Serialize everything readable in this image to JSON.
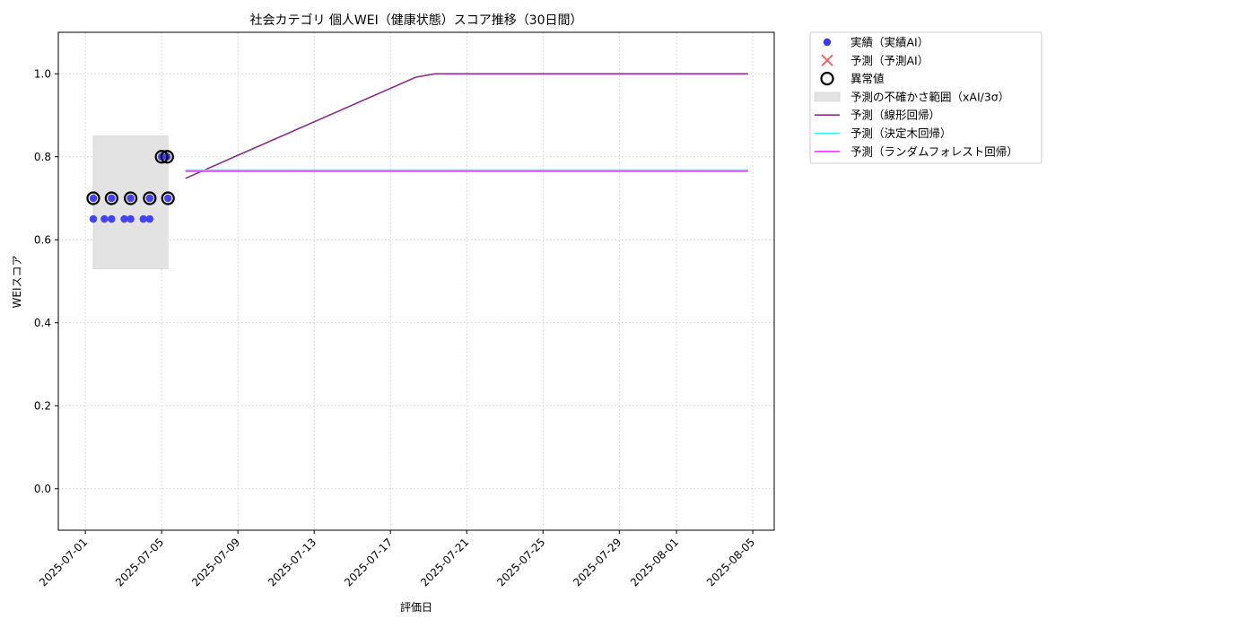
{
  "chart_data": {
    "type": "line",
    "title": "社会カテゴリ 個人WEI（健康状態）スコア推移（30日間）",
    "xlabel": "評価日",
    "ylabel": "WEIスコア",
    "xlim": [
      "2025-06-29 14:00",
      "2025-08-06 03:00"
    ],
    "ylim": [
      -0.1,
      1.1
    ],
    "x_ticks": [
      "2025-07-01",
      "2025-07-05",
      "2025-07-09",
      "2025-07-13",
      "2025-07-17",
      "2025-07-21",
      "2025-07-25",
      "2025-07-29",
      "2025-08-01",
      "2025-08-05"
    ],
    "y_ticks": [
      0.0,
      0.2,
      0.4,
      0.6,
      0.8,
      1.0
    ],
    "y_tick_labels": [
      "0.0",
      "0.2",
      "0.4",
      "0.6",
      "0.8",
      "1.0"
    ],
    "grid": true,
    "legend_position": "outside-top-right",
    "uncertainty_band": {
      "name": "予測の不確かさ範囲（xAI/3σ）",
      "x_start": "2025-07-01 10:00",
      "x_end": "2025-07-05 08:00",
      "y_low": 0.53,
      "y_high": 0.85,
      "color": "#e3e3e3"
    },
    "series": [
      {
        "name": "実績（実績AI）",
        "kind": "scatter",
        "color": "#3a3af2",
        "points": [
          [
            "2025-07-01 10:00",
            0.65
          ],
          [
            "2025-07-01 10:00",
            0.7
          ],
          [
            "2025-07-02 00:00",
            0.65
          ],
          [
            "2025-07-02 09:00",
            0.65
          ],
          [
            "2025-07-02 09:00",
            0.7
          ],
          [
            "2025-07-03 01:00",
            0.65
          ],
          [
            "2025-07-03 09:00",
            0.65
          ],
          [
            "2025-07-03 09:00",
            0.7
          ],
          [
            "2025-07-04 01:00",
            0.65
          ],
          [
            "2025-07-04 09:00",
            0.65
          ],
          [
            "2025-07-04 09:00",
            0.7
          ],
          [
            "2025-07-05 00:00",
            0.8
          ],
          [
            "2025-07-05 07:00",
            0.8
          ],
          [
            "2025-07-05 08:00",
            0.7
          ]
        ]
      },
      {
        "name": "予測（予測AI）",
        "kind": "marker-x",
        "color": "#ff3b3b",
        "points": []
      },
      {
        "name": "異常値",
        "kind": "ring",
        "color": "#000000",
        "points": [
          [
            "2025-07-01 10:00",
            0.7
          ],
          [
            "2025-07-02 09:00",
            0.7
          ],
          [
            "2025-07-03 09:00",
            0.7
          ],
          [
            "2025-07-04 09:00",
            0.7
          ],
          [
            "2025-07-05 00:00",
            0.8
          ],
          [
            "2025-07-05 07:00",
            0.8
          ],
          [
            "2025-07-05 08:00",
            0.7
          ]
        ]
      },
      {
        "name": "予測（線形回帰）",
        "kind": "line",
        "color": "#8e2b8e",
        "points": [
          [
            "2025-07-06 06:00",
            0.748
          ],
          [
            "2025-07-18 08:00",
            0.992
          ],
          [
            "2025-07-19 08:00",
            1.0
          ],
          [
            "2025-08-04 18:00",
            1.0
          ]
        ]
      },
      {
        "name": "予測（決定木回帰）",
        "kind": "line",
        "color": "#33f5f5",
        "points": [
          [
            "2025-07-06 06:00",
            0.768
          ],
          [
            "2025-08-04 18:00",
            0.768
          ]
        ]
      },
      {
        "name": "予測（ランダムフォレスト回帰）",
        "kind": "line",
        "color": "#f53af5",
        "points": [
          [
            "2025-07-06 06:00",
            0.765
          ],
          [
            "2025-08-04 18:00",
            0.765
          ]
        ]
      }
    ]
  }
}
